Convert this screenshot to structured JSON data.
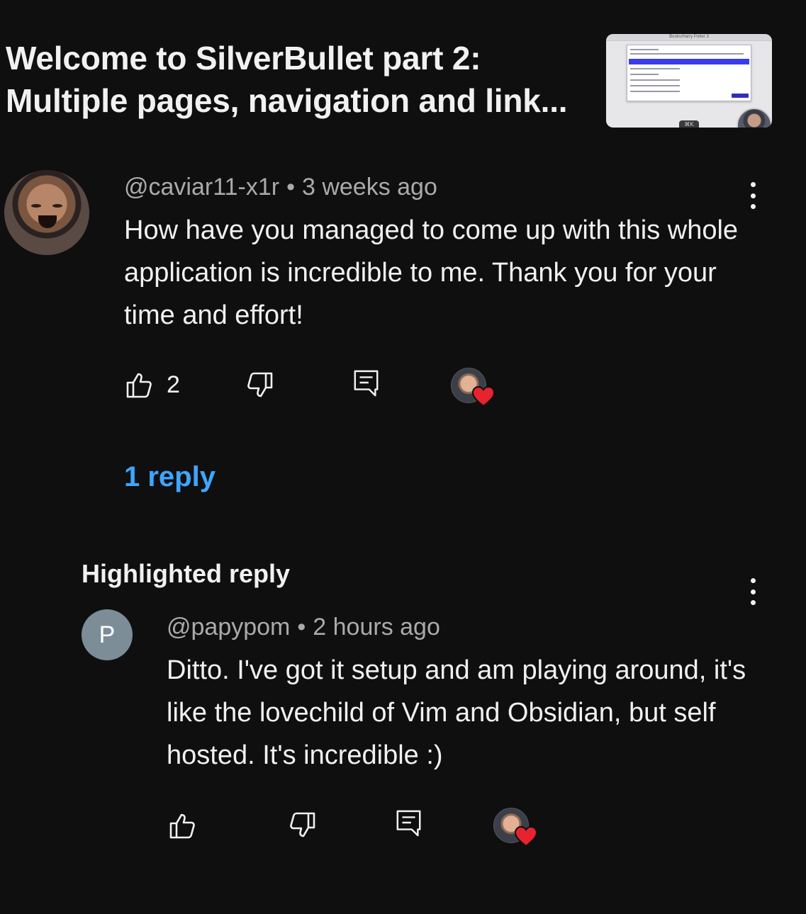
{
  "video": {
    "title": "Welcome to SilverBullet part 2: Multiple pages, navigation and link...",
    "thumbnail": {
      "window_title": "Books/Harry Potter 3",
      "shortcut_badge": "⌘K"
    }
  },
  "comment": {
    "author": "@caviar11-x1r",
    "separator": "•",
    "time": "3 weeks ago",
    "text": "How have you managed to come up with this whole application is incredible to me. Thank you for your time and effort!",
    "likes": "2",
    "replies_link": "1 reply"
  },
  "highlighted": {
    "label": "Highlighted reply",
    "reply": {
      "avatar_letter": "P",
      "author": "@papypom",
      "separator": "•",
      "time": "2 hours ago",
      "text": "Ditto. I've got it setup and am playing around, it's like the lovechild of Vim and Obsidian, but self hosted. It's incredible :)"
    }
  },
  "colors": {
    "background": "#0f0f10",
    "link": "#3ea6ff",
    "heart": "#e6232f",
    "meta": "#aaaaaa"
  },
  "icons": {
    "like": "thumbs-up-icon",
    "dislike": "thumbs-down-icon",
    "reply": "comment-icon",
    "more": "more-vertical-icon",
    "creator_heart": "creator-heart-icon"
  }
}
